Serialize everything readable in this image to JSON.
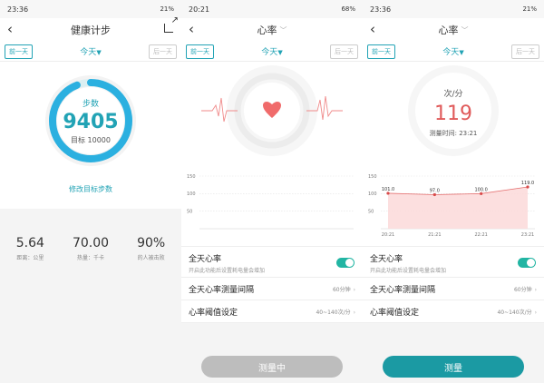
{
  "phones": [
    {
      "status": {
        "time": "23:36",
        "right": "21%"
      },
      "title": "健康计步",
      "prev_day": "前一天",
      "day": "今天",
      "next_day": "后一天",
      "steps_label": "步数",
      "steps_value": "9405",
      "goal": "目标 10000",
      "goal_progress": 0.94,
      "modify_goal": "修改目标步数",
      "stats": [
        {
          "value": "5.64",
          "label": "距离：公里"
        },
        {
          "value": "70.00",
          "label": "热量：千卡"
        },
        {
          "value": "90%",
          "label": "的人被击败"
        }
      ]
    },
    {
      "status": {
        "time": "20:21",
        "right": "68%"
      },
      "title": "心率",
      "prev_day": "前一天",
      "day": "今天",
      "next_day": "后一天",
      "all_day": "全天心率",
      "all_day_sub": "开启此功能后设置耗电量会增加",
      "interval_label": "全天心率测量间隔",
      "interval_value": "60分钟",
      "threshold_label": "心率阈值设定",
      "threshold_value": "40~140次/分",
      "button": "测量中"
    },
    {
      "status": {
        "time": "23:36",
        "right": "21%"
      },
      "title": "心率",
      "prev_day": "前一天",
      "day": "今天",
      "next_day": "后一天",
      "unit": "次/分",
      "hr_value": "119",
      "measure_time": "测量时间: 23:21",
      "all_day": "全天心率",
      "all_day_sub": "开启此功能后设置耗电量会增加",
      "interval_label": "全天心率测量间隔",
      "interval_value": "60分钟",
      "threshold_label": "心率阈值设定",
      "threshold_value": "40~140次/分",
      "button": "测量"
    }
  ],
  "colors": {
    "accent": "#22a3b5",
    "heart": "#f06b6b",
    "button_active": "#1b9aa3",
    "button_busy": "#bdbdbd"
  },
  "chart_data": [
    {
      "type": "area",
      "yticks": [
        "150",
        "100",
        "50"
      ],
      "ylim": [
        0,
        150
      ],
      "x": [],
      "values": []
    },
    {
      "type": "area",
      "yticks": [
        "150",
        "100",
        "50"
      ],
      "ylim": [
        0,
        150
      ],
      "x": [
        "20:21",
        "21:21",
        "22:21",
        "23:21"
      ],
      "values": [
        101,
        97,
        100,
        119
      ],
      "labels": [
        "101.0",
        "97.0",
        "100.0",
        "119.0"
      ]
    }
  ]
}
